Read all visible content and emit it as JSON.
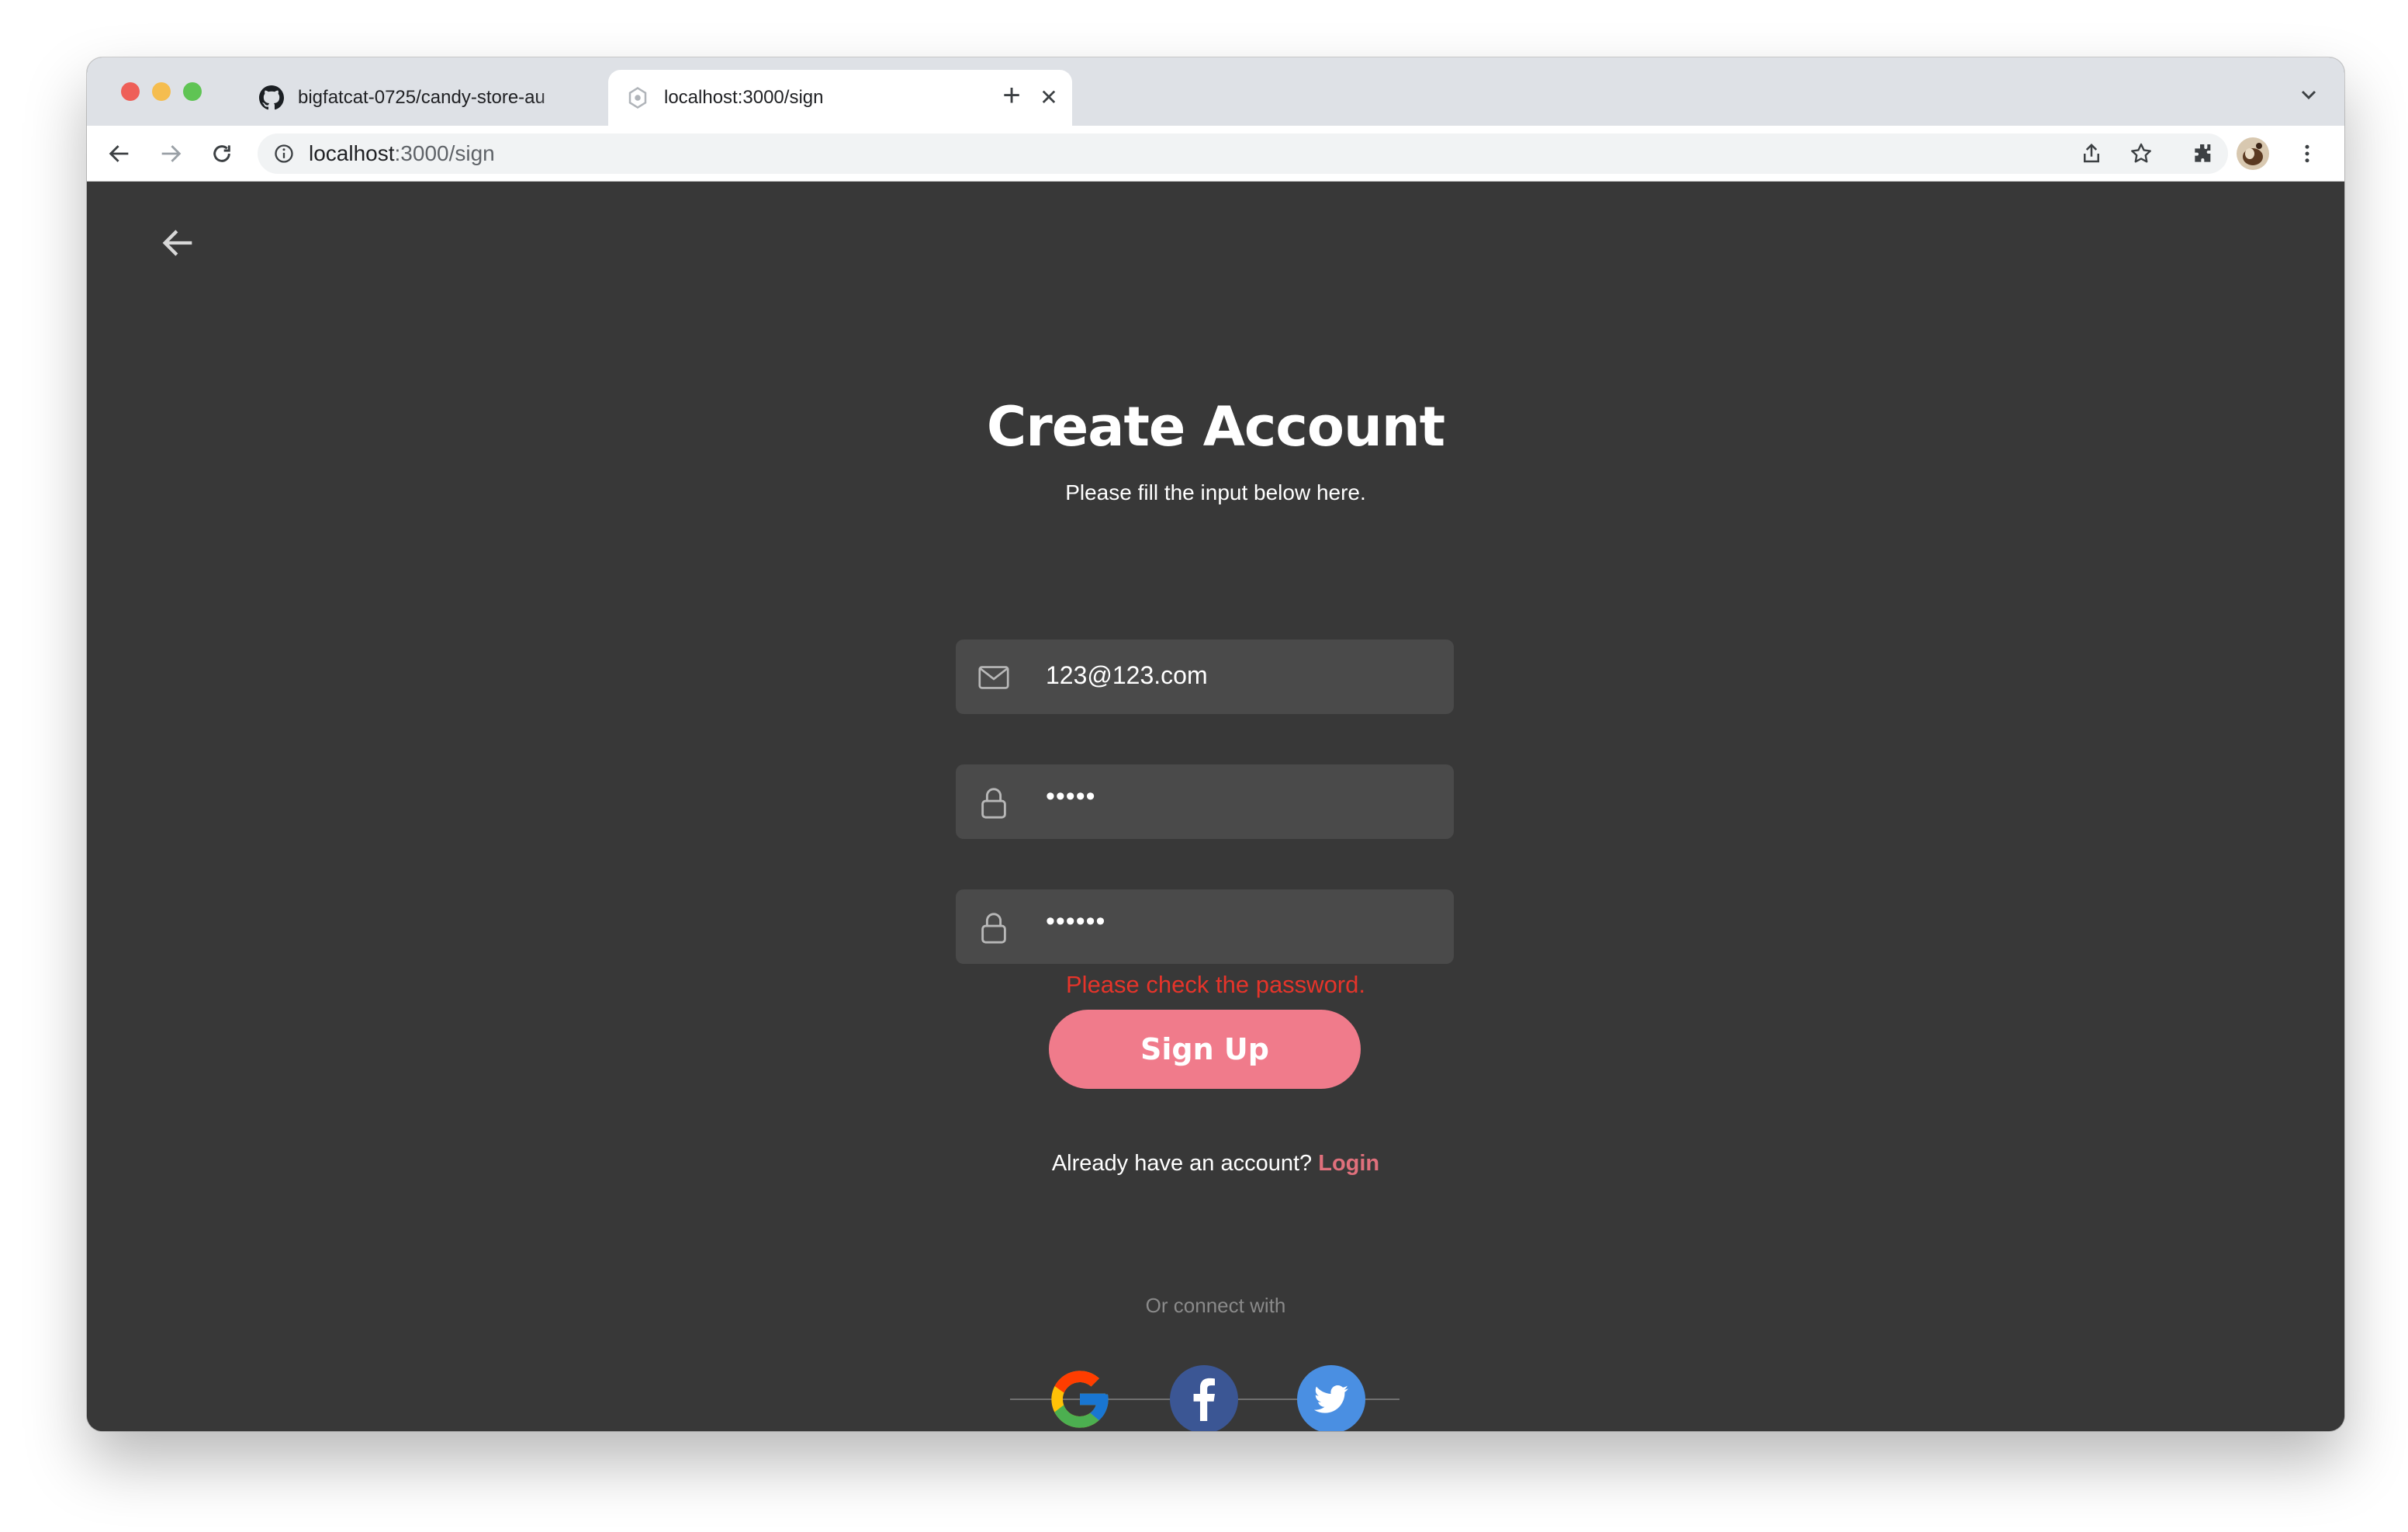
{
  "browser": {
    "tabs": [
      {
        "title": "bigfatcat-0725/candy-store-au",
        "icon": "github-icon",
        "active": false
      },
      {
        "title": "localhost:3000/sign",
        "icon": "page-icon",
        "active": true
      }
    ],
    "new_tab": "+",
    "close_glyph": "✕",
    "address": {
      "host": "localhost",
      "path": ":3000/sign"
    }
  },
  "page": {
    "title": "Create Account",
    "subtitle": "Please fill the input below here.",
    "email": {
      "value": "123@123.com",
      "icon": "mail-icon"
    },
    "password": {
      "value": "•••••",
      "icon": "lock-icon"
    },
    "confirm_password": {
      "value": "••••••",
      "icon": "lock-icon"
    },
    "error": "Please check the password.",
    "signup_label": "Sign Up",
    "login_prompt": "Already have an account?",
    "login_link": "Login",
    "connect_label": "Or connect with",
    "socials": [
      "google-icon",
      "facebook-icon",
      "twitter-icon"
    ]
  },
  "colors": {
    "background": "#383838",
    "field": "#4a4a4a",
    "accent": "#f07b8b",
    "error": "#e5342a",
    "facebook": "#3b5694",
    "twitter": "#4a8fe2"
  }
}
